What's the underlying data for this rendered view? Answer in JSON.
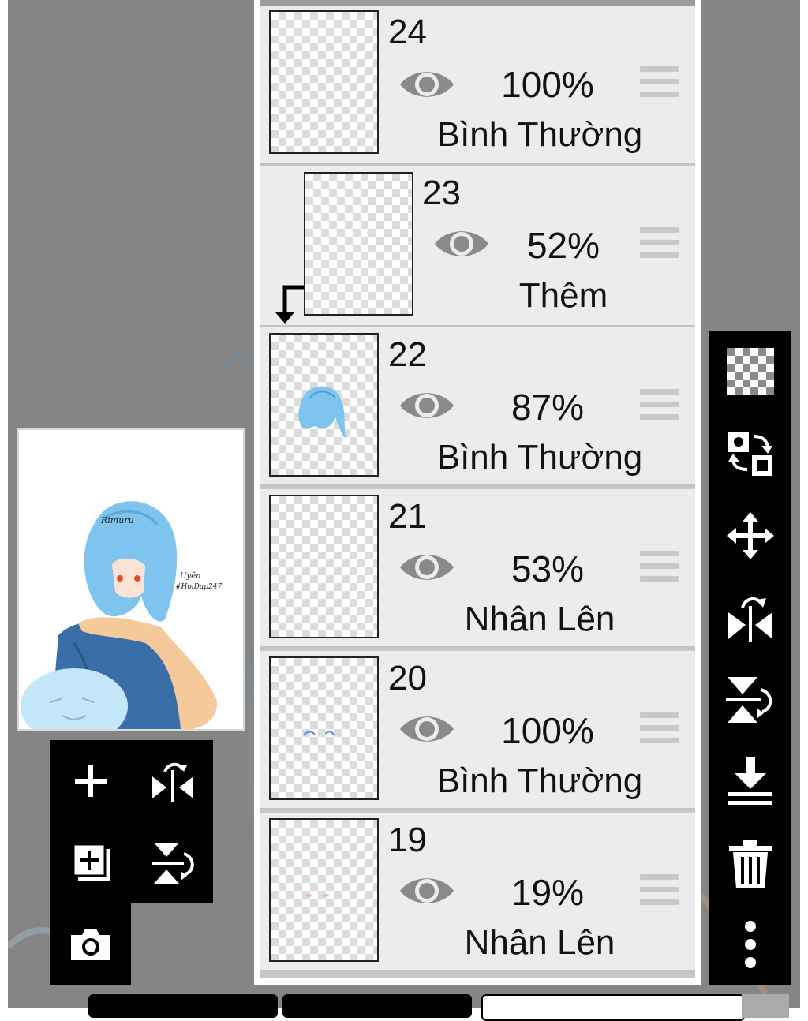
{
  "layers": [
    {
      "number": "24",
      "opacity": "100%",
      "blend": "Bình Thường",
      "clipped": false
    },
    {
      "number": "23",
      "opacity": "52%",
      "blend": "Thêm",
      "clipped": true
    },
    {
      "number": "22",
      "opacity": "87%",
      "blend": "Bình Thường",
      "clipped": false
    },
    {
      "number": "21",
      "opacity": "53%",
      "blend": "Nhân Lên",
      "clipped": false
    },
    {
      "number": "20",
      "opacity": "100%",
      "blend": "Bình Thường",
      "clipped": false
    },
    {
      "number": "19",
      "opacity": "19%",
      "blend": "Nhân Lên",
      "clipped": false
    }
  ],
  "preview": {
    "title_text": "Rimuru",
    "signature_line1": "Uyên",
    "signature_line2": "#HoiDap247"
  },
  "left_toolbar": {
    "icons": [
      "add-layer-icon",
      "flip-horizontal-icon",
      "add-copy-layer-icon",
      "flip-vertical-icon",
      "camera-icon"
    ]
  },
  "right_toolbar": {
    "icons": [
      "transparency-icon",
      "swap-layers-icon",
      "move-icon",
      "flip-horizontal-icon",
      "flip-vertical-icon",
      "merge-down-icon",
      "trash-icon",
      "more-icon"
    ]
  },
  "colors": {
    "canvas_gray": "#858585",
    "panel_row": "#ececec",
    "toolbar": "#000000",
    "eye_gray": "#8a8a8a",
    "hair_blue": "#7ec4ee"
  }
}
